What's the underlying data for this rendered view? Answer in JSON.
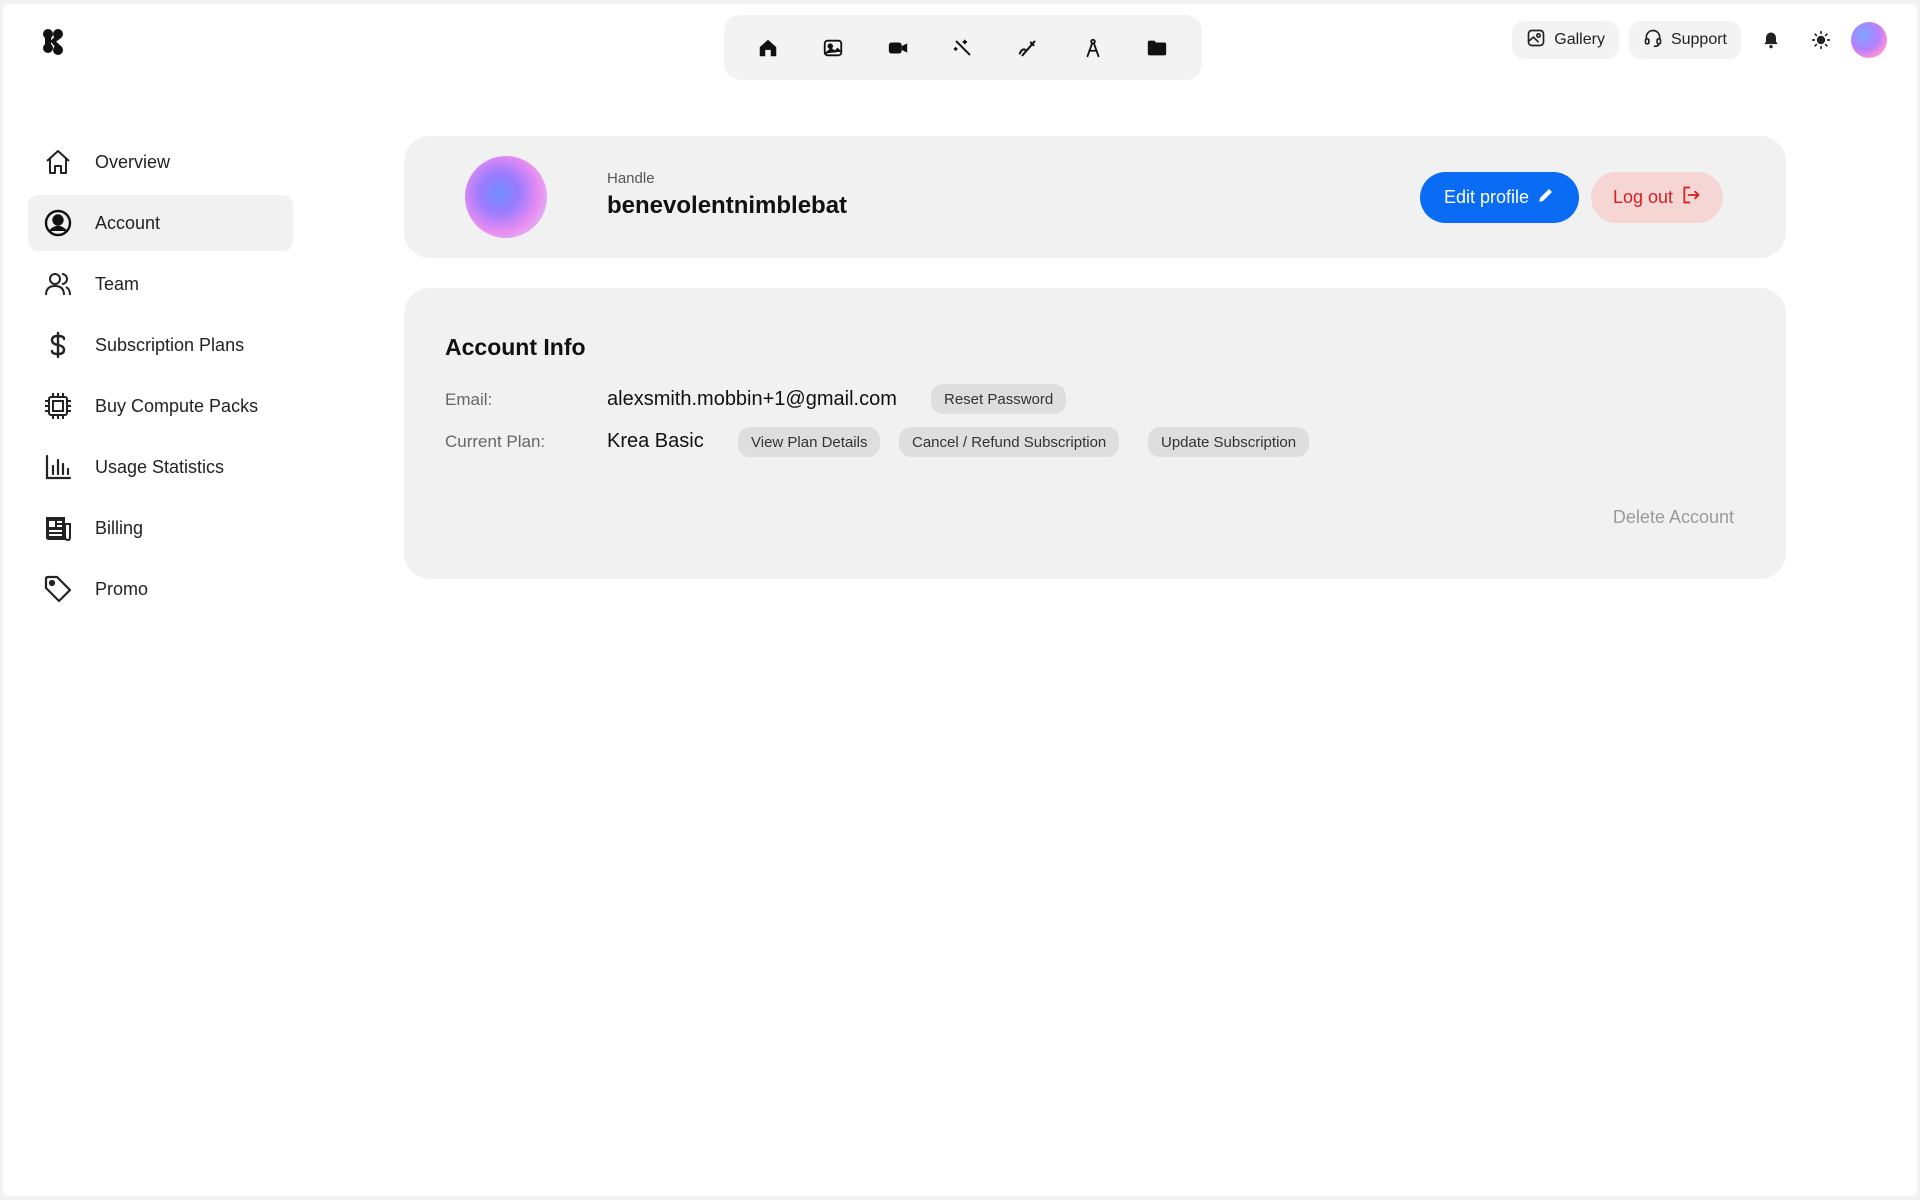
{
  "brand": {
    "logo_icon": "krea-logo-icon"
  },
  "toolbar": {
    "items": [
      {
        "name": "home-icon"
      },
      {
        "name": "image-icon"
      },
      {
        "name": "video-icon"
      },
      {
        "name": "enhance-wand-icon"
      },
      {
        "name": "realtime-pen-icon"
      },
      {
        "name": "train-compass-icon"
      },
      {
        "name": "folder-icon"
      }
    ]
  },
  "header": {
    "gallery_label": "Gallery",
    "support_label": "Support"
  },
  "sidebar": {
    "items": [
      {
        "label": "Overview",
        "icon": "home-icon",
        "active": false
      },
      {
        "label": "Account",
        "icon": "user-circle-icon",
        "active": true
      },
      {
        "label": "Team",
        "icon": "team-icon",
        "active": false
      },
      {
        "label": "Subscription Plans",
        "icon": "dollar-icon",
        "active": false
      },
      {
        "label": "Buy Compute Packs",
        "icon": "chip-icon",
        "active": false
      },
      {
        "label": "Usage Statistics",
        "icon": "bar-chart-icon",
        "active": false
      },
      {
        "label": "Billing",
        "icon": "receipt-icon",
        "active": false
      },
      {
        "label": "Promo",
        "icon": "tag-icon",
        "active": false
      }
    ]
  },
  "profile": {
    "handle_label": "Handle",
    "handle": "benevolentnimblebat",
    "edit_label": "Edit profile",
    "logout_label": "Log out"
  },
  "account_info": {
    "title": "Account Info",
    "email_label": "Email:",
    "email": "alexsmith.mobbin+1@gmail.com",
    "reset_password_label": "Reset Password",
    "plan_label": "Current Plan:",
    "plan": "Krea Basic",
    "view_plan_label": "View Plan Details",
    "cancel_label": "Cancel / Refund Subscription",
    "update_label": "Update Subscription",
    "delete_label": "Delete Account"
  },
  "colors": {
    "accent": "#0a6cf5",
    "danger": "#d42121",
    "danger_bg": "#f6d5d5",
    "card_bg": "#f1f1f1"
  }
}
